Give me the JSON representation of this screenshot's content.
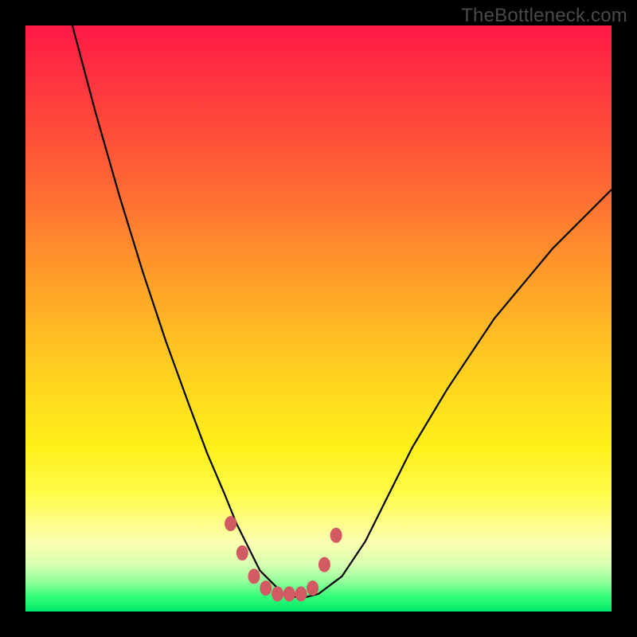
{
  "watermark": "TheBottleneck.com",
  "colors": {
    "background": "#000000",
    "curve_stroke": "#000000",
    "marker_fill": "#d15a63",
    "marker_stroke": "#d15a63"
  },
  "chart_data": {
    "type": "line",
    "title": "",
    "xlabel": "",
    "ylabel": "",
    "xlim": [
      0,
      100
    ],
    "ylim": [
      0,
      100
    ],
    "grid": false,
    "series": [
      {
        "name": "bottleneck-curve",
        "x": [
          8,
          12,
          16,
          20,
          24,
          28,
          31,
          34,
          36,
          38,
          40,
          42,
          44,
          46,
          48,
          50,
          54,
          58,
          62,
          66,
          72,
          80,
          90,
          100
        ],
        "y": [
          100,
          85,
          71,
          58,
          46,
          35,
          27,
          20,
          15,
          11,
          7,
          5,
          3,
          2.5,
          2.5,
          3,
          6,
          12,
          20,
          28,
          38,
          50,
          62,
          72
        ]
      }
    ],
    "markers": {
      "name": "highlight-dots",
      "x": [
        35,
        37,
        39,
        41,
        43,
        45,
        47,
        49,
        51,
        53
      ],
      "y": [
        15,
        10,
        6,
        4,
        3,
        3,
        3,
        4,
        8,
        13
      ]
    }
  }
}
